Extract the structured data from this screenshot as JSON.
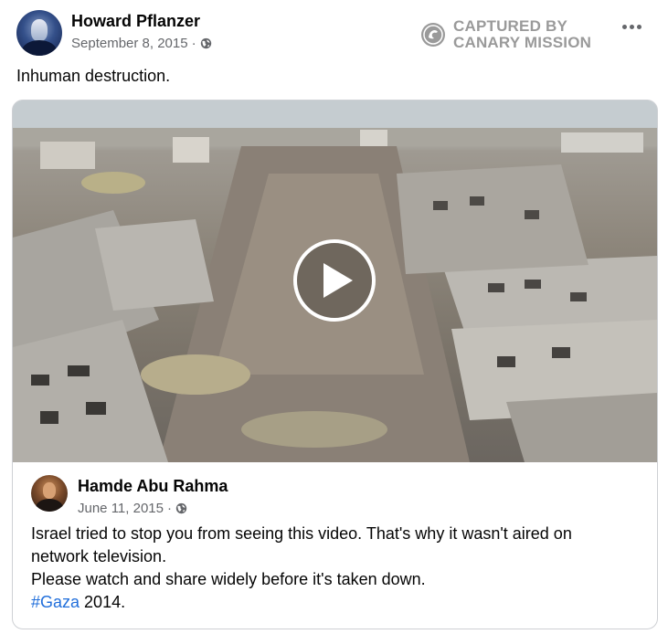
{
  "post": {
    "author": "Howard Pflanzer",
    "date": "September 8, 2015",
    "separator": "·",
    "audience_icon": "globe-icon",
    "text": "Inhuman destruction."
  },
  "watermark": {
    "line1": "CAPTURED BY",
    "line2": "CANARY MISSION",
    "icon": "canary-mission-logo-icon",
    "color": "#9a9a9a"
  },
  "menu": {
    "icon": "more-options-icon"
  },
  "video": {
    "description_icon": "play-icon"
  },
  "shared_post": {
    "author": "Hamde Abu Rahma",
    "date": "June 11, 2015",
    "separator": "·",
    "audience_icon": "globe-icon",
    "lines": [
      "Israel tried to stop you from seeing this video. That's why it wasn't aired on",
      "network television.",
      "Please watch and share widely before it's taken down."
    ],
    "hashtag": "#Gaza",
    "hashtag_suffix": " 2014."
  },
  "colors": {
    "hashtag": "#216fdb",
    "secondary_text": "#65676b",
    "border": "#ced0d4"
  }
}
